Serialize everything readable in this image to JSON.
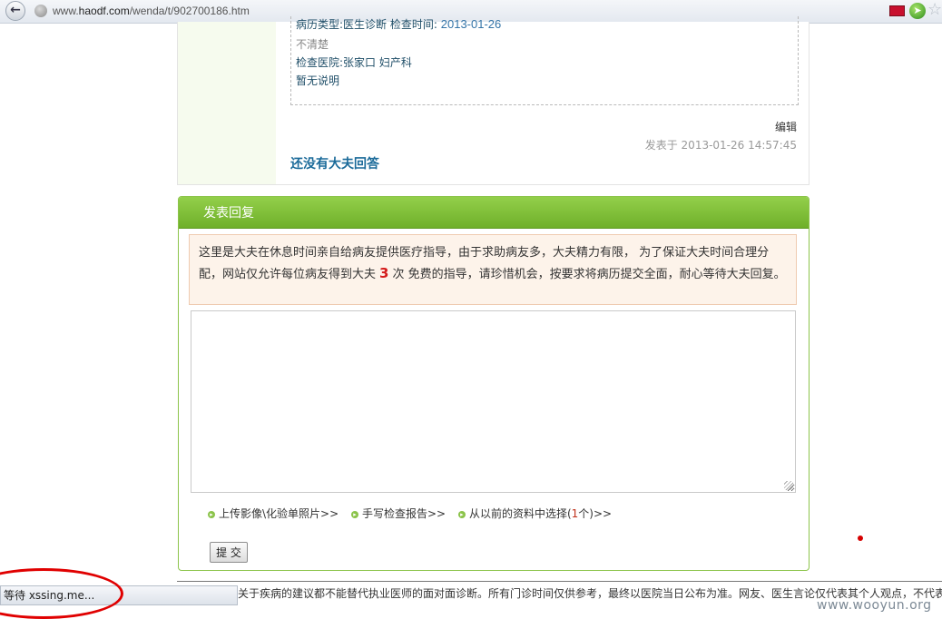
{
  "browser": {
    "url_prefix": "www.",
    "url_domain": "haodf.com",
    "url_path": "/wenda/t/902700186.htm"
  },
  "case": {
    "record_type_label": "病历类型:",
    "record_type_value": "医生诊断",
    "exam_time_label": "检查时间:",
    "exam_time_value": "2013-01-26",
    "unclear": "不清楚",
    "hospital_label": "检查医院:",
    "hospital_value": "张家口 妇产科",
    "no_description": "暂无说明",
    "edit_label": "编辑",
    "posted_label": "发表于",
    "posted_time": "2013-01-26 14:57:45",
    "no_answer": "还没有大夫回答"
  },
  "reply": {
    "header": "发表回复",
    "notice_before": "这里是大夫在休息时间亲自给病友提供医疗指导，由于求助病友多，大夫精力有限， 为了保证大夫时间合理分配，网站仅允许每位病友得到大夫",
    "notice_count": "3",
    "notice_after": "次 免费的指导，请珍惜机会，按要求将病历提交全面，耐心等待大夫回复。",
    "textarea_value": "",
    "upload_image": "上传影像\\化验单照片>>",
    "handwrite_report": "手写检查报告>>",
    "choose_previous_before": "从以前的资料中选择(",
    "choose_previous_count": "1",
    "choose_previous_after": "个)>>",
    "submit": "提 交"
  },
  "footer": {
    "disclaimer": "关于疾病的建议都不能替代执业医师的面对面诊断。所有门诊时间仅供参考，最终以医院当日公布为准。网友、医生言论仅代表其个人观点，不代表本"
  },
  "status_bar": {
    "text": "等待 xssing.me..."
  },
  "watermark": "www.wooyun.org",
  "colors": {
    "accent_green": "#7ab936",
    "notice_bg": "#fdf3ea",
    "annotation_red": "#e00000"
  }
}
